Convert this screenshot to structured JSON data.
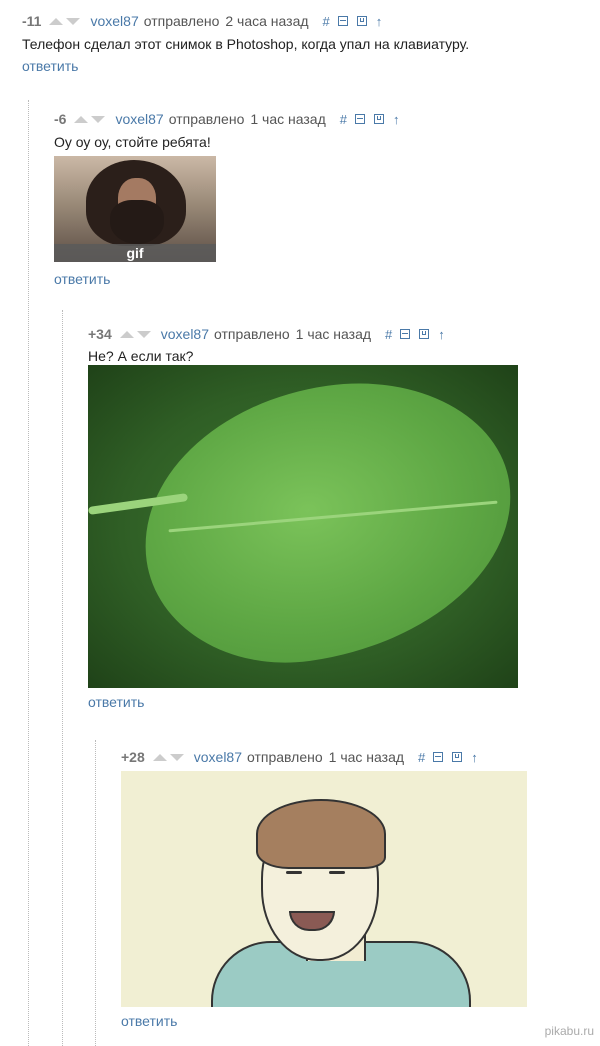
{
  "comments": [
    {
      "score": "-11",
      "author": "voxel87",
      "sent_label": "отправлено",
      "time": "2 часа назад",
      "text": "Телефон сделал этот снимок в Photoshop, когда упал на клавиатуру.",
      "reply_label": "ответить"
    },
    {
      "score": "-6",
      "author": "voxel87",
      "sent_label": "отправлено",
      "time": "1 час назад",
      "text": "Оу оу оу, стойте ребята!",
      "image_label": "gif",
      "reply_label": "ответить"
    },
    {
      "score": "+34",
      "author": "voxel87",
      "sent_label": "отправлено",
      "time": "1 час назад",
      "text": "Не? А если так?",
      "reply_label": "ответить"
    },
    {
      "score": "+28",
      "author": "voxel87",
      "sent_label": "отправлено",
      "time": "1 час назад",
      "reply_label": "ответить"
    }
  ],
  "action_icons": {
    "link": "#",
    "collapse": "minus-box-icon",
    "save": "save-icon",
    "parent": "↑"
  },
  "watermark": "pikabu.ru",
  "colors": {
    "link": "#4a79a8",
    "score": "#777777"
  }
}
